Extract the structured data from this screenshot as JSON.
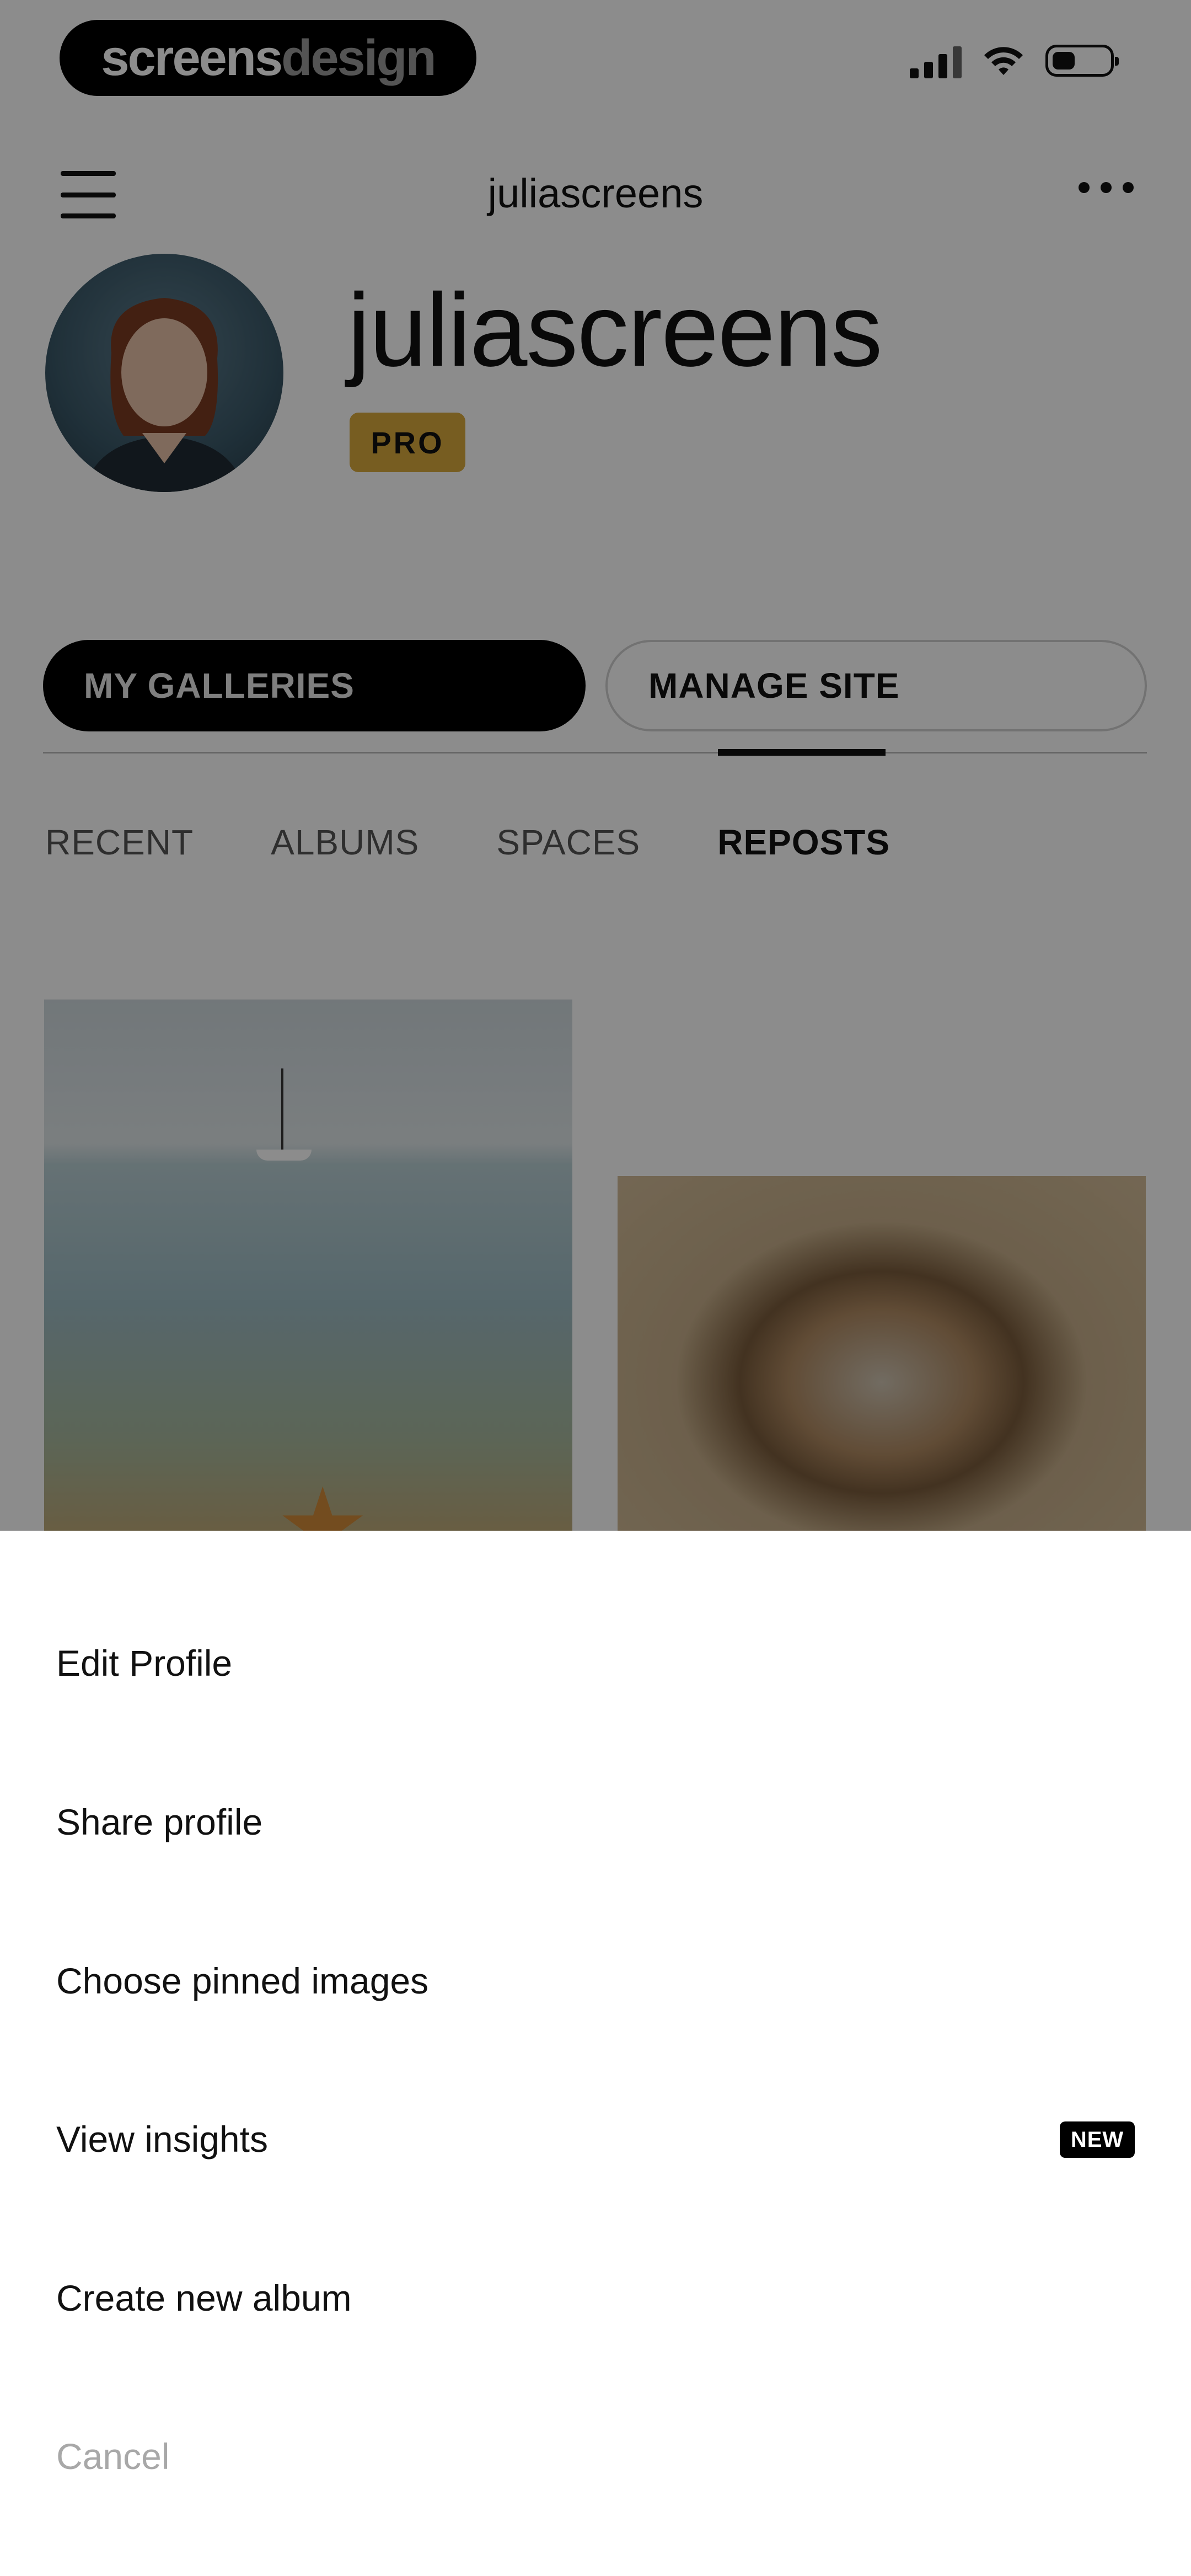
{
  "status_bar": {
    "brand_main": "screens",
    "brand_accent": "design"
  },
  "header": {
    "title": "juliascreens"
  },
  "profile": {
    "name": "juliascreens",
    "badge": "PRO"
  },
  "actions": {
    "galleries_label": "MY GALLERIES",
    "manage_label": "MANAGE SITE"
  },
  "tabs": [
    {
      "label": "RECENT",
      "active": false
    },
    {
      "label": "ALBUMS",
      "active": false
    },
    {
      "label": "SPACES",
      "active": false
    },
    {
      "label": "REPOSTS",
      "active": true
    }
  ],
  "sheet": {
    "items": [
      {
        "label": "Edit Profile"
      },
      {
        "label": "Share profile"
      },
      {
        "label": "Choose pinned images"
      },
      {
        "label": "View insights",
        "badge": "NEW"
      },
      {
        "label": "Create new album"
      },
      {
        "label": "Cancel"
      }
    ]
  },
  "colors": {
    "pro_badge": "#d9a93c",
    "primary_button": "#000000",
    "cancel_text": "#a8a8a8",
    "overlay": "rgba(0,0,0,0.45)"
  }
}
